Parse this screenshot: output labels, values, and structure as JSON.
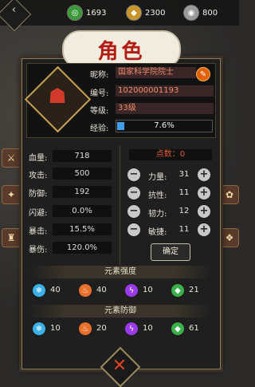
{
  "resources": [
    {
      "icon": "green-swirl-icon",
      "value": "1693",
      "color": "#3a9a3a"
    },
    {
      "icon": "gold-coin-icon",
      "value": "2300",
      "color": "#c8952a"
    },
    {
      "icon": "silver-coin-icon",
      "value": "800",
      "color": "#9a9a9a"
    }
  ],
  "title": "角色",
  "info": {
    "nickname_label": "昵称:",
    "nickname": "国家科学院院士",
    "id_label": "编号:",
    "id": "102000001193",
    "level_label": "等级:",
    "level": "33级",
    "exp_label": "经验:",
    "exp_text": "7.6%",
    "exp_fraction": 0.076
  },
  "stats": [
    {
      "label": "血量:",
      "value": "718"
    },
    {
      "label": "攻击:",
      "value": "500"
    },
    {
      "label": "防御:",
      "value": "192"
    },
    {
      "label": "闪避:",
      "value": "0.0%"
    },
    {
      "label": "暴击:",
      "value": "15.5%"
    },
    {
      "label": "暴伤:",
      "value": "120.0%"
    }
  ],
  "points": "点数：0",
  "attributes": [
    {
      "label": "力量:",
      "value": "31"
    },
    {
      "label": "抗性:",
      "value": "11"
    },
    {
      "label": "韧力:",
      "value": "12"
    },
    {
      "label": "敏捷:",
      "value": "11"
    }
  ],
  "confirm_label": "确定",
  "element_strength_title": "元素强度",
  "element_defense_title": "元素防御",
  "element_strength": [
    {
      "icon": "ice-icon",
      "value": "40",
      "color": "#3ab0e8"
    },
    {
      "icon": "fire-icon",
      "value": "40",
      "color": "#e8702a"
    },
    {
      "icon": "lightning-icon",
      "value": "10",
      "color": "#9a3ae8"
    },
    {
      "icon": "poison-icon",
      "value": "21",
      "color": "#3ab04a"
    }
  ],
  "element_defense": [
    {
      "icon": "ice-icon",
      "value": "10",
      "color": "#3ab0e8"
    },
    {
      "icon": "fire-icon",
      "value": "20",
      "color": "#e8702a"
    },
    {
      "icon": "lightning-icon",
      "value": "10",
      "color": "#9a3ae8"
    },
    {
      "icon": "poison-icon",
      "value": "61",
      "color": "#3ab04a"
    }
  ]
}
